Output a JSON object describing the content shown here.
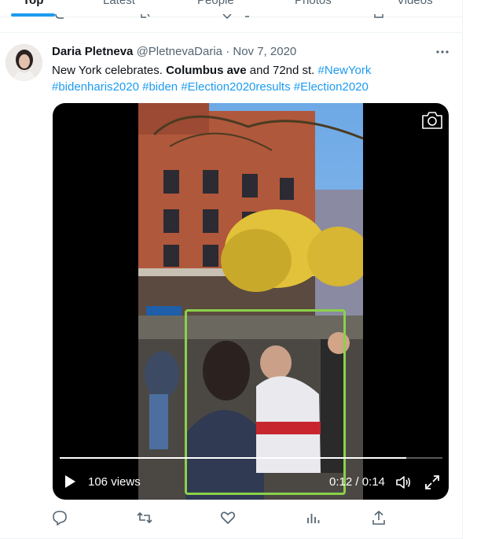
{
  "tabs": [
    {
      "label": "Top",
      "active": true
    },
    {
      "label": "Latest",
      "active": false
    },
    {
      "label": "People",
      "active": false
    },
    {
      "label": "Photos",
      "active": false
    },
    {
      "label": "Videos",
      "active": false
    }
  ],
  "tweet": {
    "author_name": "Daria Pletneva",
    "author_handle": "@PletnevaDaria",
    "separator": "·",
    "date": "Nov 7, 2020",
    "text_part1": "New York celebrates. ",
    "text_bold": "Columbus ave",
    "text_part2": " and 72nd st. ",
    "hashtags_line1": "#NewYork",
    "hashtags_line2": [
      "#bidenharis2020",
      "#biden",
      "#Election2020results",
      "#Election2020"
    ]
  },
  "video": {
    "views_label": "106 views",
    "time_label": "0:12 / 0:14",
    "progress": 0.905,
    "highlight_color": "#8bd14a"
  },
  "icons": {
    "more": "more-dots-icon",
    "camera": "camera-icon",
    "play": "play-icon",
    "volume": "volume-icon",
    "fullscreen": "fullscreen-icon",
    "reply": "reply-icon",
    "retweet": "retweet-icon",
    "like": "heart-icon",
    "views": "analytics-icon",
    "share": "share-icon"
  },
  "colors": {
    "accent": "#1d9bf0",
    "text": "#0f1419",
    "secondary": "#536471"
  }
}
